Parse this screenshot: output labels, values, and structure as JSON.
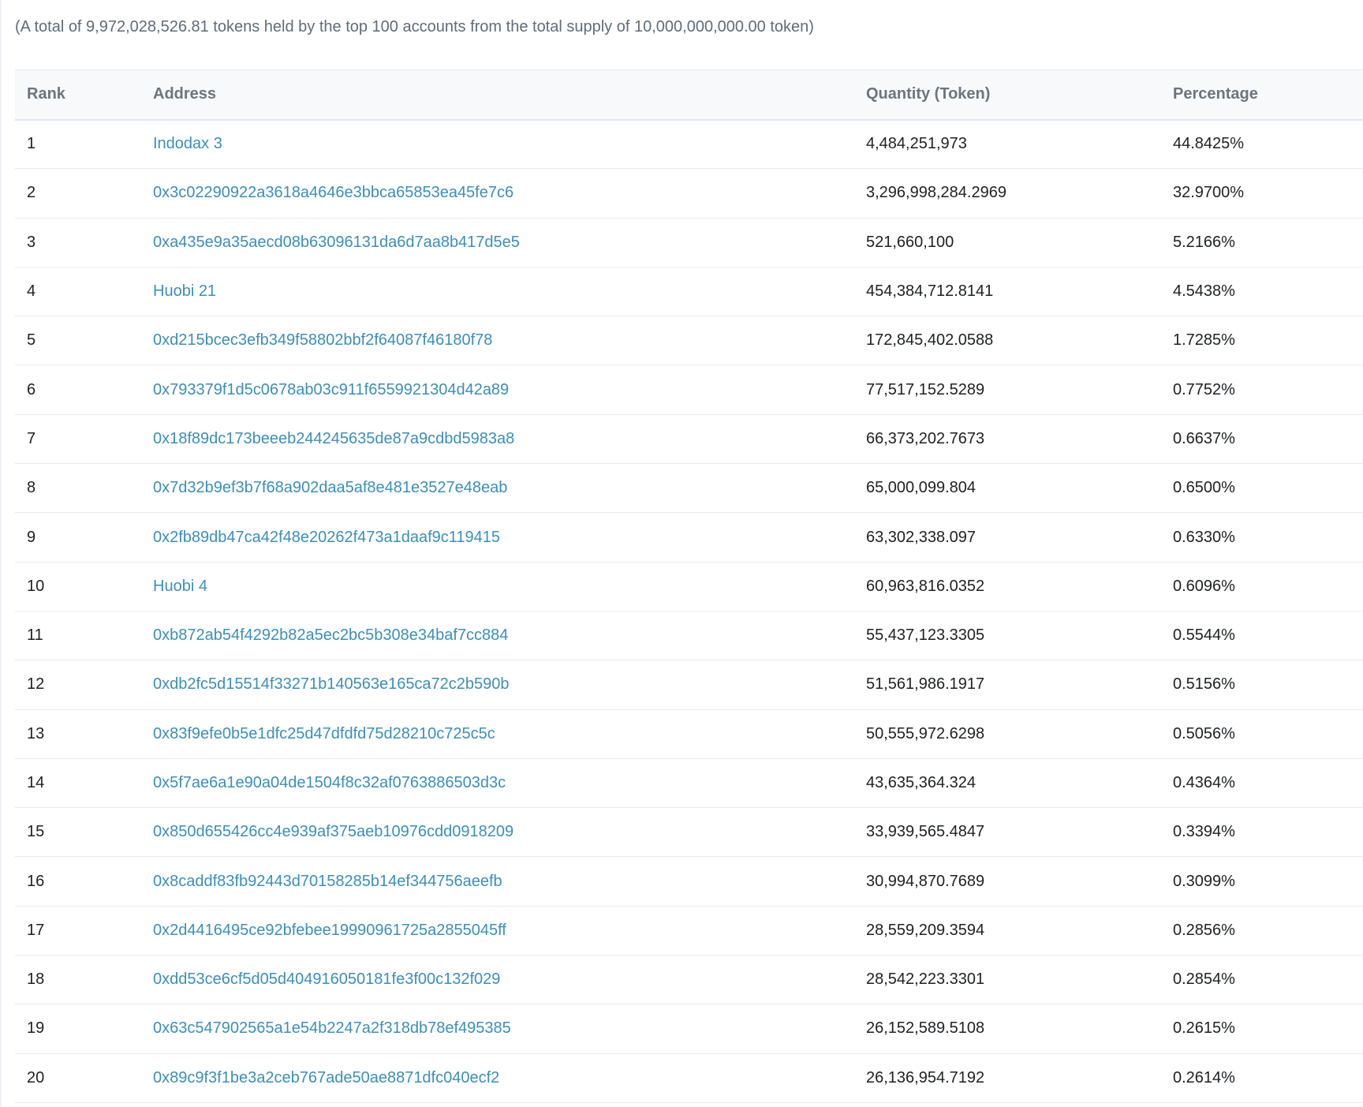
{
  "summary": "(A total of 9,972,028,526.81 tokens held by the top 100 accounts from the total supply of 10,000,000,000.00 token)",
  "columns": {
    "rank": "Rank",
    "address": "Address",
    "quantity": "Quantity (Token)",
    "percentage": "Percentage"
  },
  "colors": {
    "link": "#3a8fbd",
    "text": "#1e2022",
    "header_text": "#6c757e",
    "header_bg": "#f8f9fa"
  },
  "rows": [
    {
      "rank": "1",
      "address": "Indodax 3",
      "quantity": "4,484,251,973",
      "percentage": "44.8425%"
    },
    {
      "rank": "2",
      "address": "0x3c02290922a3618a4646e3bbca65853ea45fe7c6",
      "quantity": "3,296,998,284.2969",
      "percentage": "32.9700%"
    },
    {
      "rank": "3",
      "address": "0xa435e9a35aecd08b63096131da6d7aa8b417d5e5",
      "quantity": "521,660,100",
      "percentage": "5.2166%"
    },
    {
      "rank": "4",
      "address": "Huobi 21",
      "quantity": "454,384,712.8141",
      "percentage": "4.5438%"
    },
    {
      "rank": "5",
      "address": "0xd215bcec3efb349f58802bbf2f64087f46180f78",
      "quantity": "172,845,402.0588",
      "percentage": "1.7285%"
    },
    {
      "rank": "6",
      "address": "0x793379f1d5c0678ab03c911f6559921304d42a89",
      "quantity": "77,517,152.5289",
      "percentage": "0.7752%"
    },
    {
      "rank": "7",
      "address": "0x18f89dc173beeeb244245635de87a9cdbd5983a8",
      "quantity": "66,373,202.7673",
      "percentage": "0.6637%"
    },
    {
      "rank": "8",
      "address": "0x7d32b9ef3b7f68a902daa5af8e481e3527e48eab",
      "quantity": "65,000,099.804",
      "percentage": "0.6500%"
    },
    {
      "rank": "9",
      "address": "0x2fb89db47ca42f48e20262f473a1daaf9c119415",
      "quantity": "63,302,338.097",
      "percentage": "0.6330%"
    },
    {
      "rank": "10",
      "address": "Huobi 4",
      "quantity": "60,963,816.0352",
      "percentage": "0.6096%"
    },
    {
      "rank": "11",
      "address": "0xb872ab54f4292b82a5ec2bc5b308e34baf7cc884",
      "quantity": "55,437,123.3305",
      "percentage": "0.5544%"
    },
    {
      "rank": "12",
      "address": "0xdb2fc5d15514f33271b140563e165ca72c2b590b",
      "quantity": "51,561,986.1917",
      "percentage": "0.5156%"
    },
    {
      "rank": "13",
      "address": "0x83f9efe0b5e1dfc25d47dfdfd75d28210c725c5c",
      "quantity": "50,555,972.6298",
      "percentage": "0.5056%"
    },
    {
      "rank": "14",
      "address": "0x5f7ae6a1e90a04de1504f8c32af0763886503d3c",
      "quantity": "43,635,364.324",
      "percentage": "0.4364%"
    },
    {
      "rank": "15",
      "address": "0x850d655426cc4e939af375aeb10976cdd0918209",
      "quantity": "33,939,565.4847",
      "percentage": "0.3394%"
    },
    {
      "rank": "16",
      "address": "0x8caddf83fb92443d70158285b14ef344756aeefb",
      "quantity": "30,994,870.7689",
      "percentage": "0.3099%"
    },
    {
      "rank": "17",
      "address": "0x2d4416495ce92bfebee19990961725a2855045ff",
      "quantity": "28,559,209.3594",
      "percentage": "0.2856%"
    },
    {
      "rank": "18",
      "address": "0xdd53ce6cf5d05d404916050181fe3f00c132f029",
      "quantity": "28,542,223.3301",
      "percentage": "0.2854%"
    },
    {
      "rank": "19",
      "address": "0x63c547902565a1e54b2247a2f318db78ef495385",
      "quantity": "26,152,589.5108",
      "percentage": "0.2615%"
    },
    {
      "rank": "20",
      "address": "0x89c9f3f1be3a2ceb767ade50ae8871dfc040ecf2",
      "quantity": "26,136,954.7192",
      "percentage": "0.2614%"
    }
  ]
}
